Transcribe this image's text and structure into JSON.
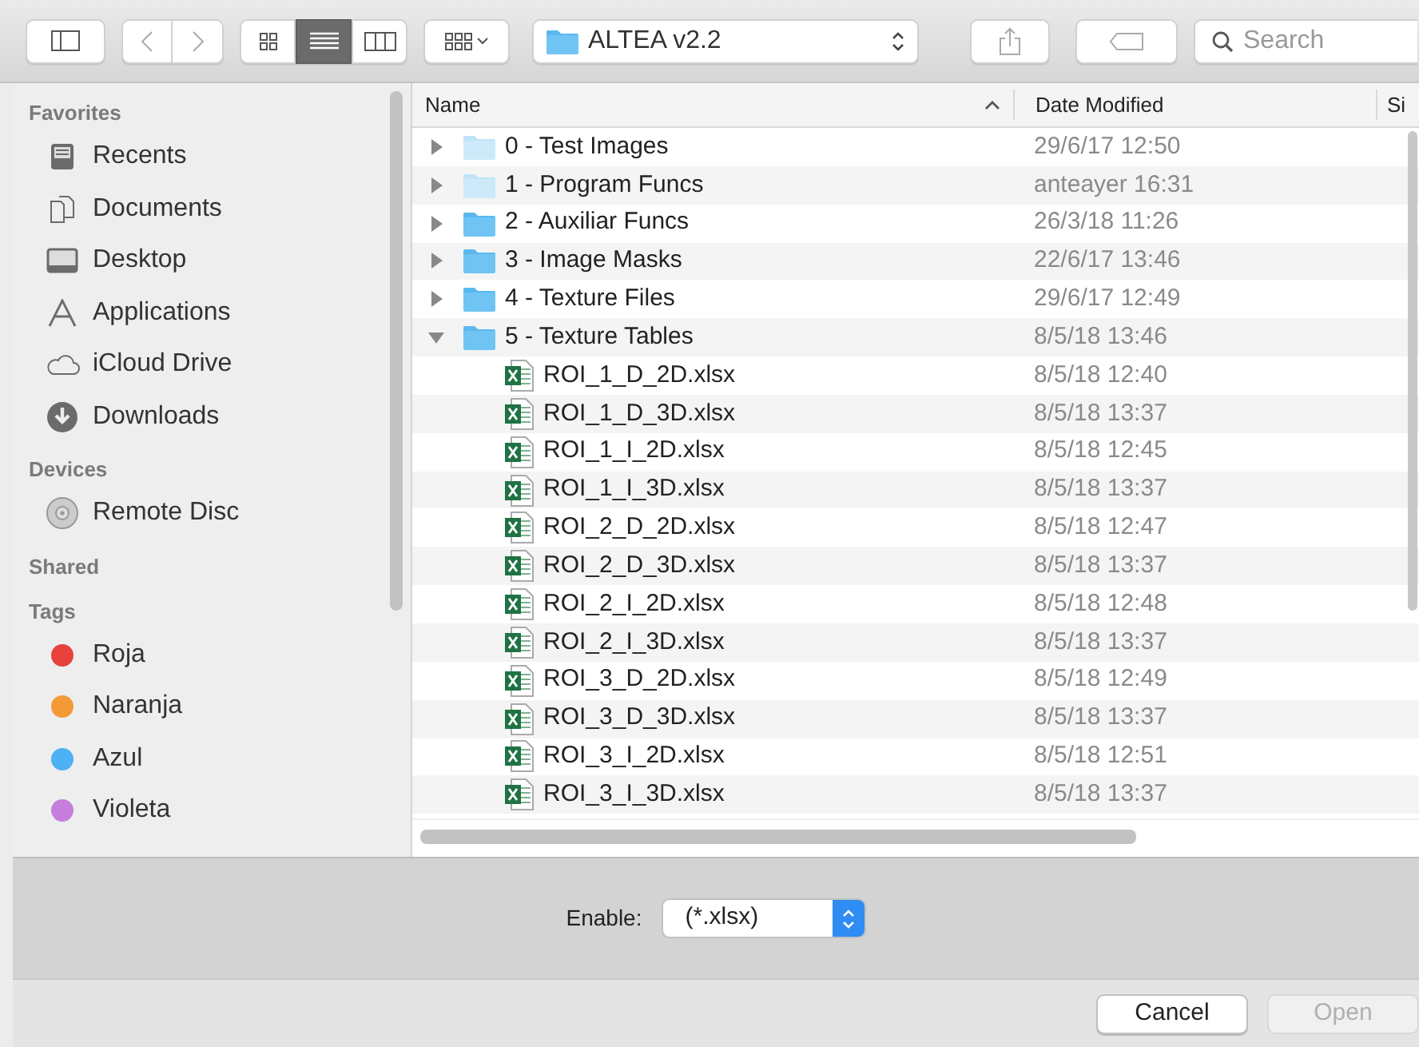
{
  "toolbar": {
    "view_modes": [
      {
        "kind": "icons",
        "selected": false
      },
      {
        "kind": "list",
        "selected": true
      },
      {
        "kind": "columns",
        "selected": false
      }
    ],
    "location": "ALTEA v2.2",
    "search": {
      "placeholder": "Search"
    }
  },
  "sidebar": {
    "sections": [
      {
        "title": "Favorites",
        "items": [
          {
            "kind": "recents",
            "label": "Recents"
          },
          {
            "kind": "documents",
            "label": "Documents"
          },
          {
            "kind": "desktop",
            "label": "Desktop"
          },
          {
            "kind": "applications",
            "label": "Applications"
          },
          {
            "kind": "icloud",
            "label": "iCloud Drive"
          },
          {
            "kind": "downloads",
            "label": "Downloads"
          }
        ]
      },
      {
        "title": "Devices",
        "items": [
          {
            "kind": "disc",
            "label": "Remote Disc"
          }
        ]
      },
      {
        "title": "Shared"
      },
      {
        "title": "Tags",
        "items": [
          {
            "kind": "tag",
            "label": "Roja",
            "color": "#e8413c"
          },
          {
            "kind": "tag",
            "label": "Naranja",
            "color": "#f39a37"
          },
          {
            "kind": "tag",
            "label": "Azul",
            "color": "#4cb1f5"
          },
          {
            "kind": "tag",
            "label": "Violeta",
            "color": "#c77ddc"
          }
        ]
      }
    ]
  },
  "table": {
    "columns": [
      "Name",
      "Date Modified",
      "Si"
    ],
    "rows": [
      {
        "kind": "folder",
        "name": "0 - Test Images",
        "date": "29/6/17 12:50",
        "expanded": false,
        "dimmed": true
      },
      {
        "kind": "folder",
        "name": "1 - Program Funcs",
        "date": "anteayer 16:31",
        "expanded": false,
        "dimmed": true
      },
      {
        "kind": "folder",
        "name": "2 - Auxiliar Funcs",
        "date": "26/3/18 11:26",
        "expanded": false,
        "dimmed": false
      },
      {
        "kind": "folder",
        "name": "3 - Image Masks",
        "date": "22/6/17 13:46",
        "expanded": false,
        "dimmed": false
      },
      {
        "kind": "folder",
        "name": "4 - Texture Files",
        "date": "29/6/17 12:49",
        "expanded": false,
        "dimmed": false
      },
      {
        "kind": "folder",
        "name": "5 - Texture Tables",
        "date": "8/5/18 13:46",
        "expanded": true,
        "dimmed": false,
        "children": [
          {
            "kind": "file",
            "name": "ROI_1_D_2D.xlsx",
            "date": "8/5/18 12:40"
          },
          {
            "kind": "file",
            "name": "ROI_1_D_3D.xlsx",
            "date": "8/5/18 13:37"
          },
          {
            "kind": "file",
            "name": "ROI_1_I_2D.xlsx",
            "date": "8/5/18 12:45"
          },
          {
            "kind": "file",
            "name": "ROI_1_I_3D.xlsx",
            "date": "8/5/18 13:37"
          },
          {
            "kind": "file",
            "name": "ROI_2_D_2D.xlsx",
            "date": "8/5/18 12:47"
          },
          {
            "kind": "file",
            "name": "ROI_2_D_3D.xlsx",
            "date": "8/5/18 13:37"
          },
          {
            "kind": "file",
            "name": "ROI_2_I_2D.xlsx",
            "date": "8/5/18 12:48"
          },
          {
            "kind": "file",
            "name": "ROI_2_I_3D.xlsx",
            "date": "8/5/18 13:37"
          },
          {
            "kind": "file",
            "name": "ROI_3_D_2D.xlsx",
            "date": "8/5/18 12:49"
          },
          {
            "kind": "file",
            "name": "ROI_3_D_3D.xlsx",
            "date": "8/5/18 13:37"
          },
          {
            "kind": "file",
            "name": "ROI_3_I_2D.xlsx",
            "date": "8/5/18 12:51"
          },
          {
            "kind": "file",
            "name": "ROI_3_I_3D.xlsx",
            "date": "8/5/18 13:37"
          }
        ]
      }
    ]
  },
  "options": {
    "label": "Enable:",
    "value": "(*.xlsx)"
  },
  "buttons": [
    {
      "label": "Cancel",
      "disabled": false
    },
    {
      "label": "Open",
      "disabled": true
    }
  ]
}
